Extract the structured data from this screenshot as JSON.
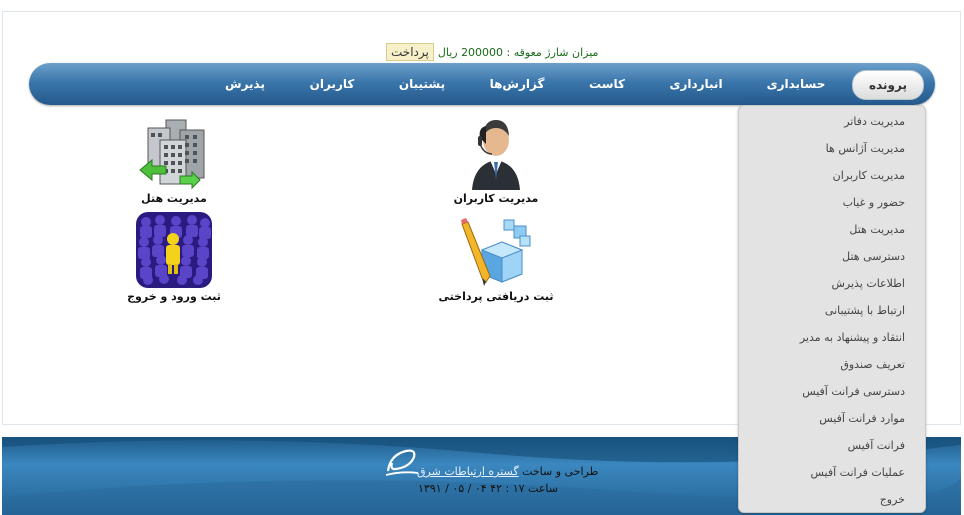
{
  "charge": {
    "pay_label": "پرداخت",
    "text": "میزان شارژ معوقه : 200000 ریال"
  },
  "nav": {
    "items": [
      {
        "label": "پرونده"
      },
      {
        "label": "حسابداری"
      },
      {
        "label": "انبارداری"
      },
      {
        "label": "کاست"
      },
      {
        "label": "گزارش‌ها"
      },
      {
        "label": "پشتیبان"
      },
      {
        "label": "کاربران"
      },
      {
        "label": "پذیرش"
      }
    ]
  },
  "dropdown": {
    "items": [
      "مدیریت دفاتر",
      "مدیریت آژانس ها",
      "مدیریت کاربران",
      "حضور و غیاب",
      "مدیریت هتل",
      "دسترسی هتل",
      "اطلاعات پذیرش",
      "ارتباط با پشتیبانی",
      "انتقاد و پیشنهاد به مدیر",
      "تعریف صندوق",
      "دسترسی فرانت آفیس",
      "موارد فرانت آفیس",
      "فرانت آفیس",
      "عملیات فرانت آفیس",
      "خروج"
    ]
  },
  "tiles": {
    "hotel": "مدیریت هتل",
    "users": "مدیریت کاربران",
    "checkin": "ثبت ورود و خروج",
    "payments": "ثبت دریافتی پرداختی"
  },
  "footer": {
    "credit_prefix": "طراحی و ساخت",
    "company_link": "گستره ارتباطات شرق",
    "date": "۱۳۹۱ / ۰۵ / ۰۴ ساعت ۱۷ : ۴۲"
  },
  "colors": {
    "nav": "#3b76ab",
    "footer": "#2e74a8",
    "dropdown": "#e3e3e3"
  }
}
